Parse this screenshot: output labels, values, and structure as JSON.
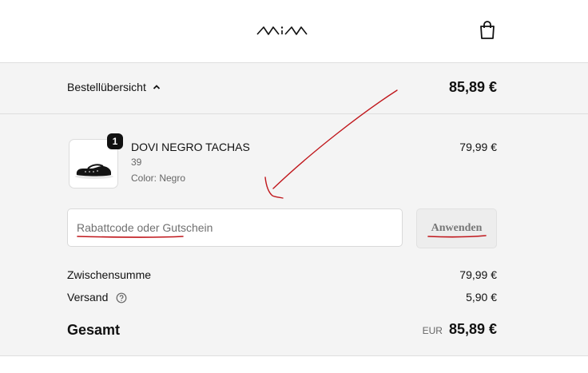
{
  "brand": {
    "logo_text": "MiM"
  },
  "header": {
    "cart_icon": "shopping-bag-icon"
  },
  "summary_bar": {
    "toggle_label": "Bestellübersicht",
    "toggle_icon": "chevron-up-icon",
    "total": "85,89 €"
  },
  "cart_items": [
    {
      "quantity": "1",
      "name": "DOVI NEGRO TACHAS",
      "size": "39",
      "color": "Color: Negro",
      "price": "79,99 €"
    }
  ],
  "discount": {
    "placeholder": "Rabattcode oder Gutschein",
    "apply_label": "Anwenden"
  },
  "totals": {
    "subtotal_label": "Zwischensumme",
    "subtotal_value": "79,99 €",
    "shipping_label": "Versand",
    "shipping_help_icon": "question-circle-icon",
    "shipping_value": "5,90 €",
    "grand_total_label": "Gesamt",
    "currency": "EUR",
    "grand_total_value": "85,89 €"
  },
  "colors": {
    "annotation": "#c0171c",
    "panel_bg": "#f4f4f4",
    "text": "#111111"
  }
}
